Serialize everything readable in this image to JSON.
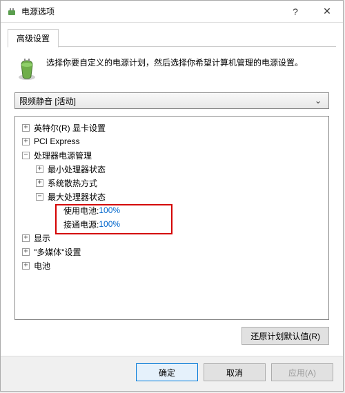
{
  "window": {
    "title": "电源选项"
  },
  "tabs": {
    "advanced": "高级设置"
  },
  "intro": {
    "text": "选择你要自定义的电源计划，然后选择你希望计算机管理的电源设置。"
  },
  "combo": {
    "selected": "限频静音 [活动]"
  },
  "tree": {
    "intel_graphics": "英特尔(R) 显卡设置",
    "pci_express": "PCI Express",
    "cpu_power": "处理器电源管理",
    "min_cpu_state": "最小处理器状态",
    "cooling_policy": "系统散热方式",
    "max_cpu_state": "最大处理器状态",
    "on_battery_label": "使用电池: ",
    "on_battery_value": "100%",
    "plugged_in_label": "接通电源: ",
    "plugged_in_value": "100%",
    "display": "显示",
    "multimedia": "\"多媒体\"设置",
    "battery": "电池"
  },
  "buttons": {
    "restore": "还原计划默认值(R)",
    "ok": "确定",
    "cancel": "取消",
    "apply": "应用(A)"
  }
}
